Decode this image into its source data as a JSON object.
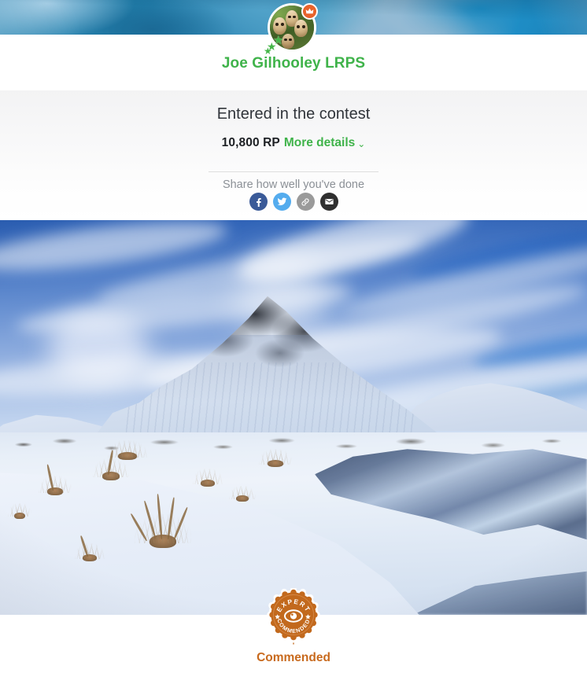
{
  "banner": {
    "alt": "iceberg-cover-photo"
  },
  "profile": {
    "avatar_alt": "owls-profile-photo",
    "crown_icon": "crown-icon",
    "stars_icon": "green-stars-icon",
    "username": "Joe Gilhooley LRPS",
    "username_color": "#3fb34a"
  },
  "contest": {
    "title": "Entered in the contest",
    "points": "10,800 RP",
    "more_details_label": "More details",
    "chevron": "⌄",
    "accent_color": "#3fb34a"
  },
  "share": {
    "label": "Share how well you've done",
    "buttons": [
      {
        "name": "facebook",
        "icon": "facebook-icon",
        "color": "#3a5a98"
      },
      {
        "name": "twitter",
        "icon": "twitter-icon",
        "color": "#54acee"
      },
      {
        "name": "link",
        "icon": "link-icon",
        "color": "#9a9a9a"
      },
      {
        "name": "email",
        "icon": "email-icon",
        "color": "#2f2f2f"
      }
    ]
  },
  "photo": {
    "alt": "snow-covered-mountain-and-frozen-river-photo"
  },
  "award": {
    "seal_top_text": "EXPERT",
    "seal_bottom_text": "COMMENDED",
    "seal_icon": "eye-icon",
    "caption": "Commended",
    "color": "#c86a1e"
  }
}
